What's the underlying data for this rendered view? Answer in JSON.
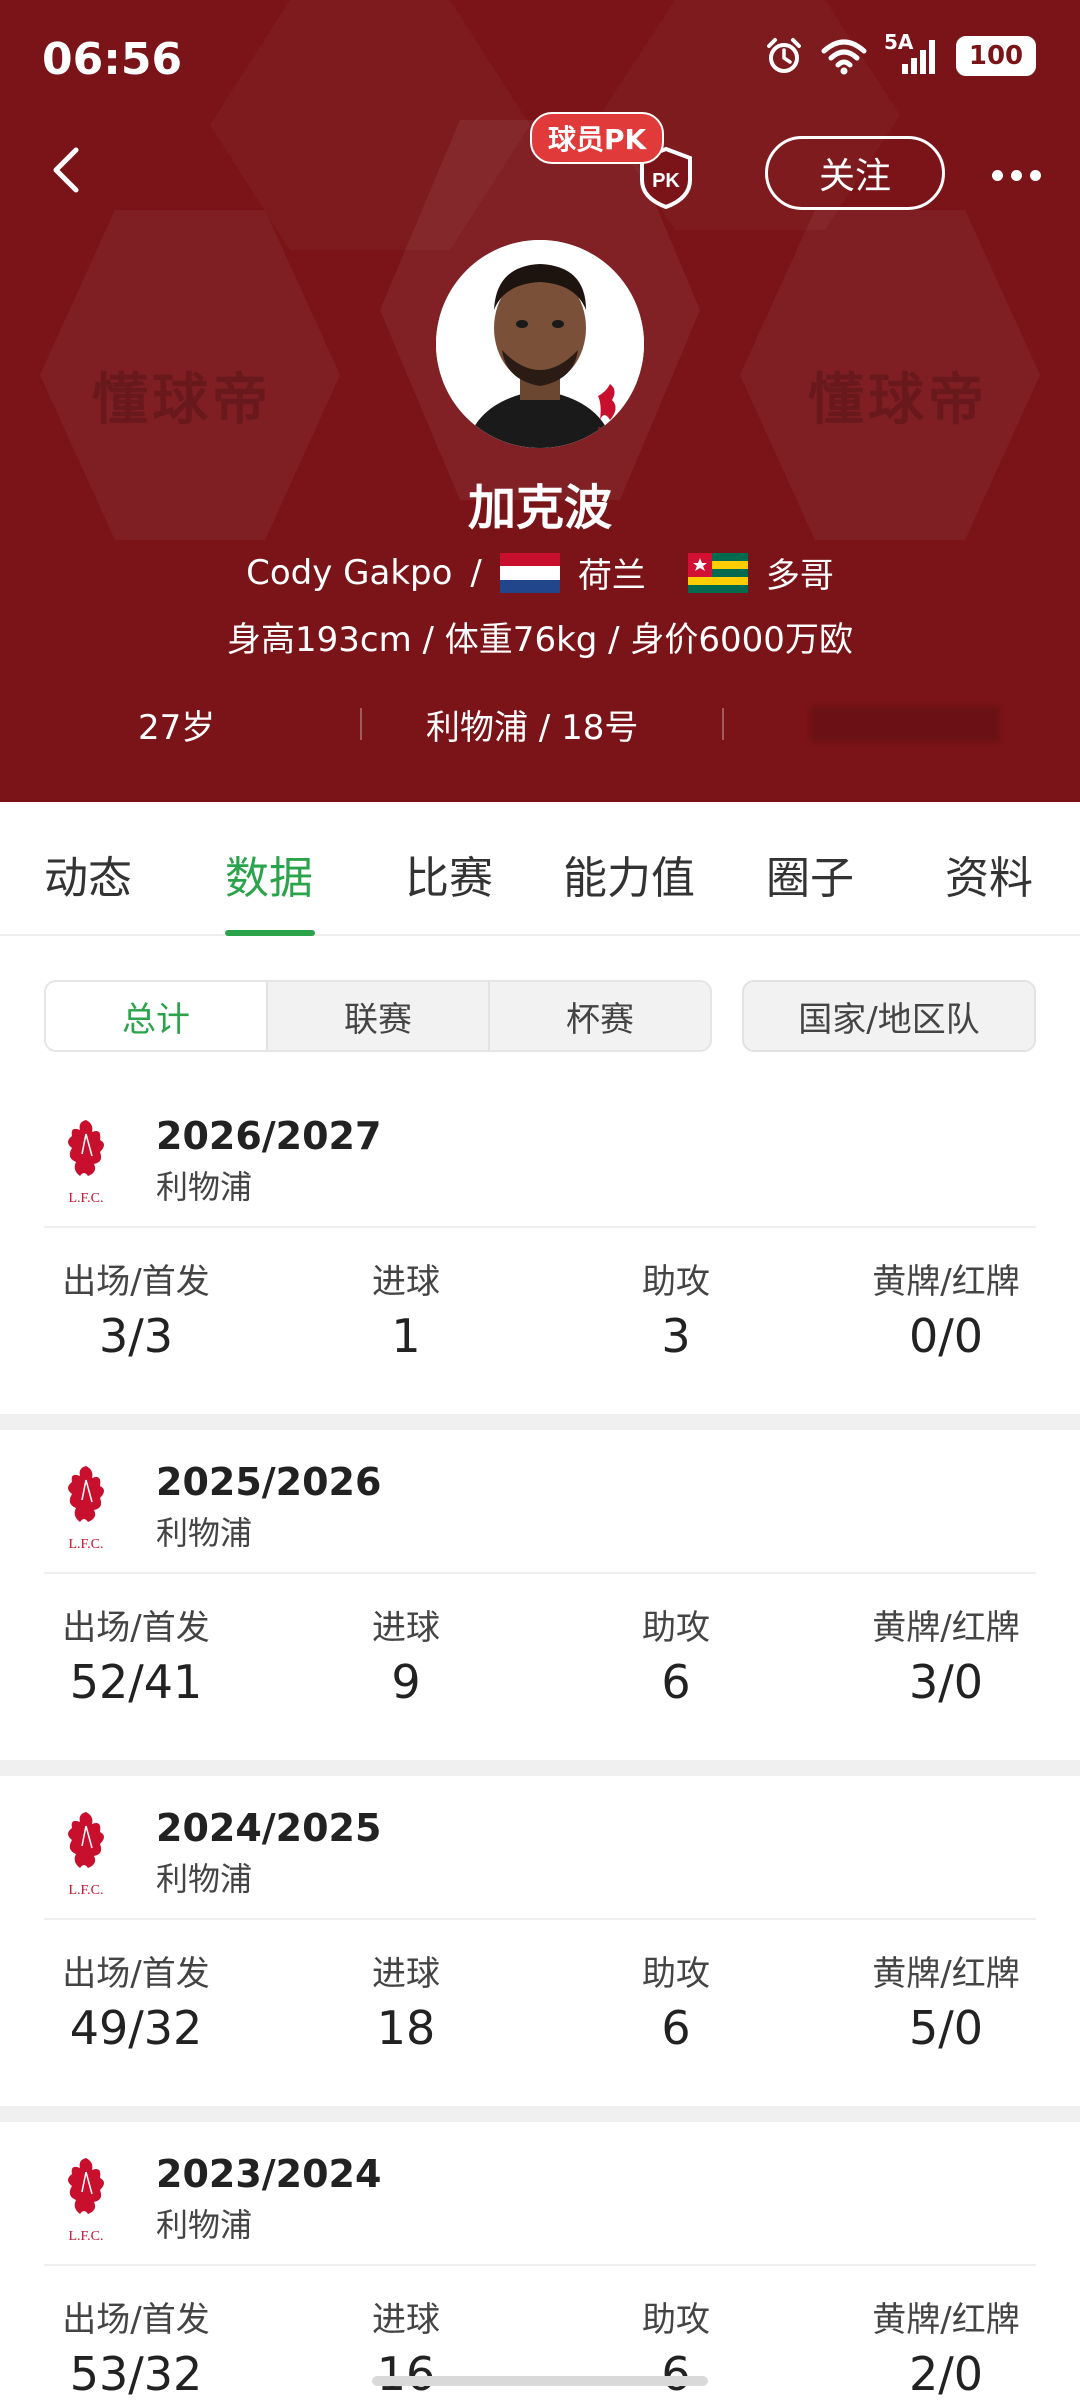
{
  "status_bar": {
    "time": "06:56",
    "network": "5A",
    "battery": "100"
  },
  "header": {
    "pk_label": "球员PK",
    "pk_icon_text": "PK",
    "follow_label": "关注",
    "watermark_left": "懂球帝",
    "watermark_right": "懂球帝",
    "player_name": "加克波",
    "english_name": "Cody Gakpo",
    "separator": "/",
    "nation1": "荷兰",
    "nation2": "多哥",
    "body_info": "身高193cm / 体重76kg / 身价6000万欧",
    "age": "27岁",
    "club_number": "利物浦 / 18号",
    "accent": "#7a1418"
  },
  "tabs": [
    {
      "label": "动态"
    },
    {
      "label": "数据"
    },
    {
      "label": "比赛"
    },
    {
      "label": "能力值"
    },
    {
      "label": "圈子"
    },
    {
      "label": "资料"
    }
  ],
  "active_tab": "数据",
  "filters": {
    "segments": [
      "总计",
      "联赛",
      "杯赛"
    ],
    "national_team": "国家/地区队"
  },
  "stat_labels": {
    "apps": "出场/首发",
    "goals": "进球",
    "assists": "助攻",
    "cards": "黄牌/红牌"
  },
  "seasons": [
    {
      "year": "2026/2027",
      "team": "利物浦",
      "apps": "3/3",
      "goals": "1",
      "assists": "3",
      "cards": "0/0"
    },
    {
      "year": "2025/2026",
      "team": "利物浦",
      "apps": "52/41",
      "goals": "9",
      "assists": "6",
      "cards": "3/0"
    },
    {
      "year": "2024/2025",
      "team": "利物浦",
      "apps": "49/32",
      "goals": "18",
      "assists": "6",
      "cards": "5/0"
    },
    {
      "year": "2023/2024",
      "team": "利物浦",
      "apps": "53/32",
      "goals": "16",
      "assists": "6",
      "cards": "2/0"
    }
  ],
  "logo_text": "L.F.C.",
  "colors": {
    "accent_green": "#2aa34b",
    "header_red": "#7a1418",
    "liverpool_red": "#c8102e"
  }
}
